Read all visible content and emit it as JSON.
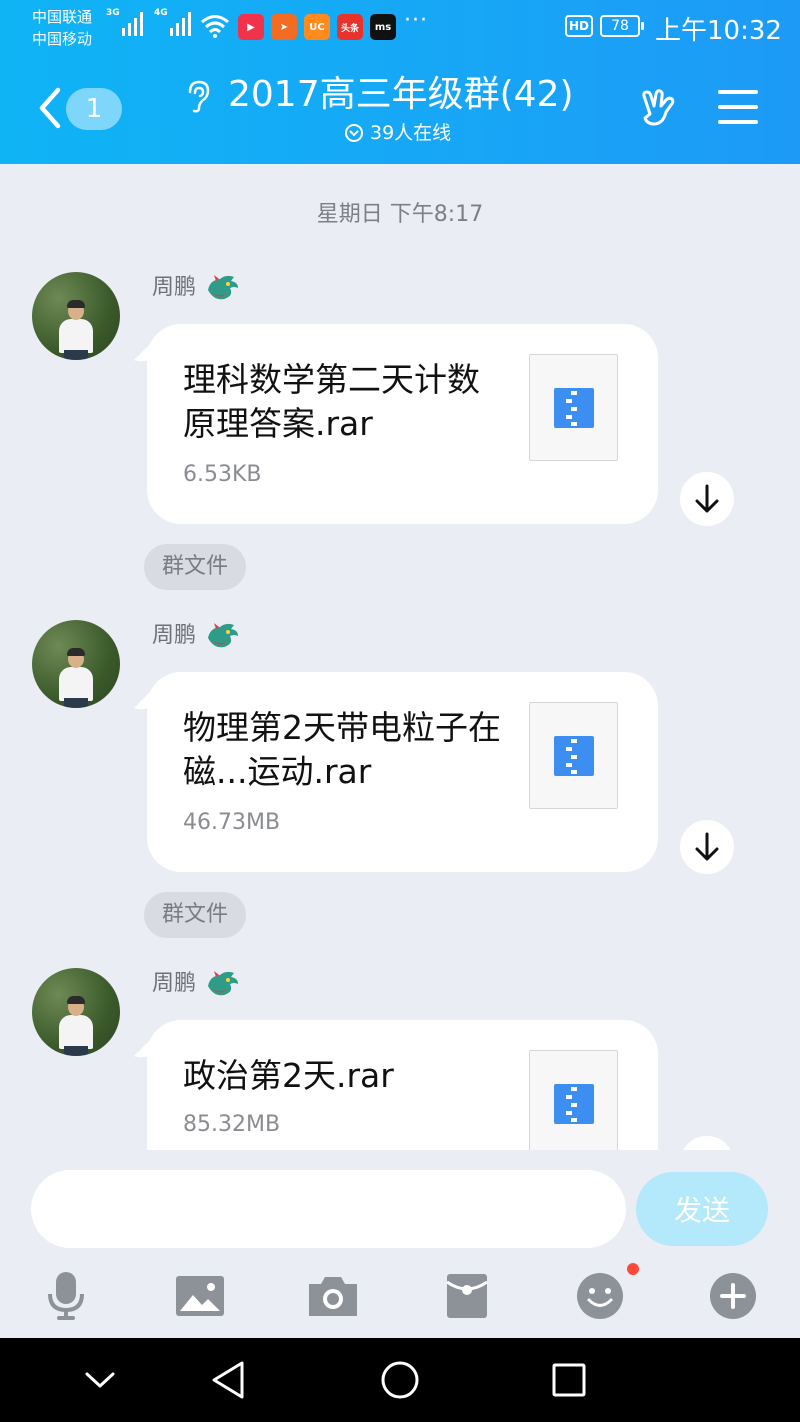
{
  "status_bar": {
    "carrier_1": "中国联通",
    "carrier_2": "中国移动",
    "net_1": "3G",
    "net_2": "4G",
    "more": "···",
    "hd": "HD",
    "battery": "78",
    "time": "上午10:32",
    "app_icons": [
      "video-app-icon",
      "send-app-icon",
      "uc-browser-icon",
      "toutiao-icon",
      "ms-app-icon"
    ]
  },
  "header": {
    "unread_count": "1",
    "title": "2017高三年级群(42)",
    "online": "39人在线"
  },
  "chat": {
    "date_divider": "星期日 下午8:17",
    "messages": [
      {
        "sender": "周鹏",
        "file_name": "理科数学第二天计数原理答案.rar",
        "file_size": "6.53KB",
        "tag": "群文件"
      },
      {
        "sender": "周鹏",
        "file_name": "物理第2天带电粒子在磁...运动.rar",
        "file_size": "46.73MB",
        "tag": "群文件"
      },
      {
        "sender": "周鹏",
        "file_name": "政治第2天.rar",
        "file_size": "85.32MB"
      }
    ]
  },
  "input": {
    "placeholder": "",
    "send_label": "发送"
  },
  "colors": {
    "header_start": "#0fb4f5",
    "header_end": "#1d9af6",
    "chat_bg": "#ebedf5",
    "send_disabled": "#b3e9fb",
    "zip_icon": "#3c8ff0",
    "badge_dot": "#ff4a3a"
  },
  "toolbar_icons": [
    "microphone-icon",
    "image-icon",
    "camera-icon",
    "red-packet-icon",
    "emoji-icon",
    "plus-icon"
  ],
  "navbar_icons": [
    "hide-keyboard-icon",
    "back-icon",
    "home-icon",
    "recents-icon"
  ]
}
